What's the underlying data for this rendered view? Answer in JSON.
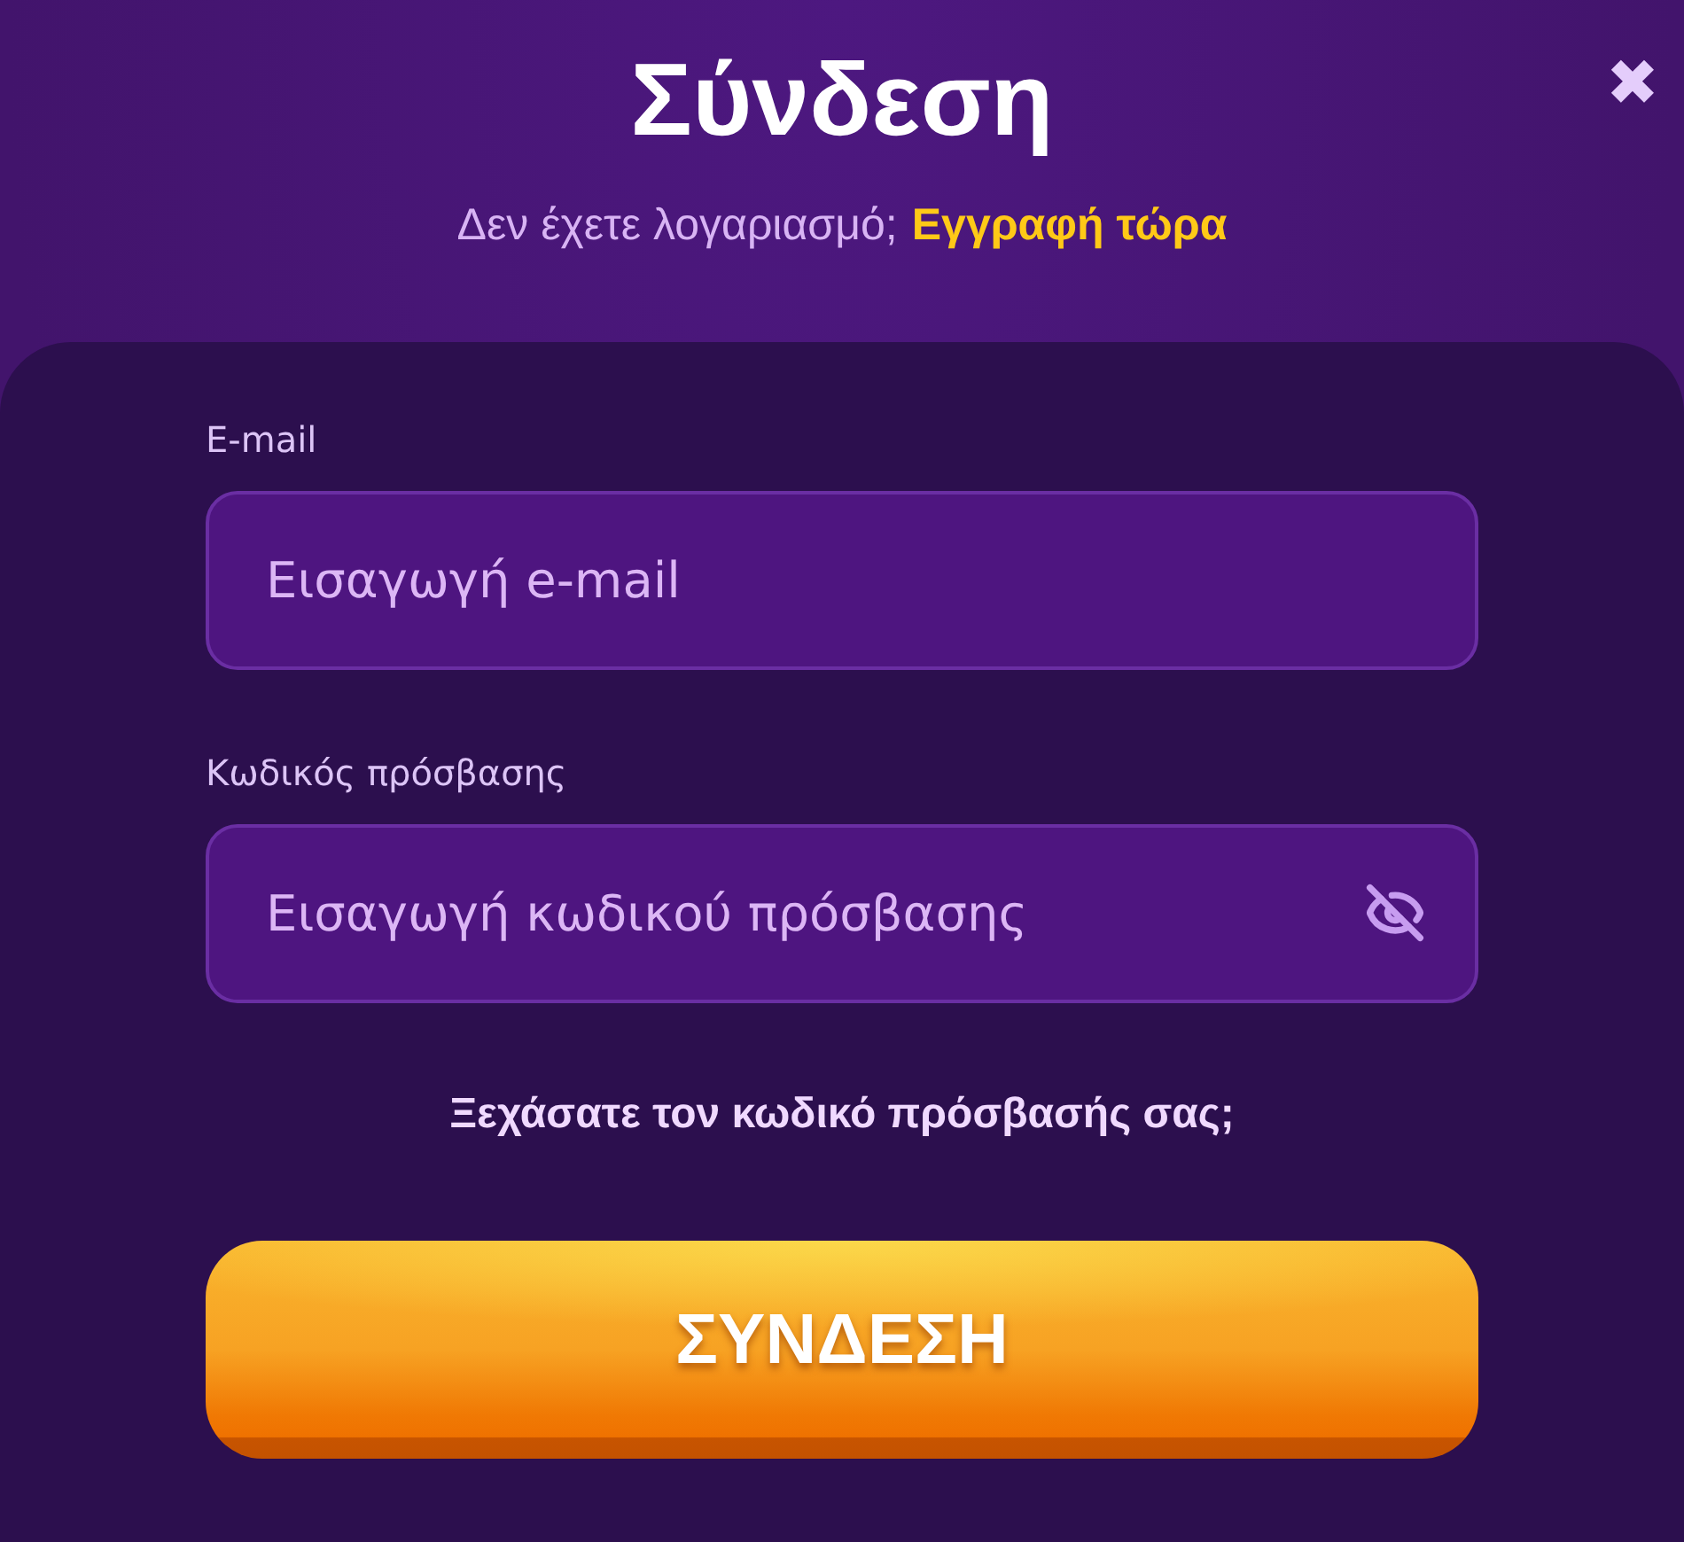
{
  "dialog": {
    "title": "Σύνδεση",
    "close": "✖"
  },
  "signup_prompt": {
    "text": "Δεν έχετε λογαριασμό;",
    "link": "Εγγραφή τώρα"
  },
  "fields": [
    {
      "kind": "text",
      "label": "E-mail",
      "placeholder": "Εισαγωγή e-mail"
    },
    {
      "kind": "password",
      "label": "Κωδικός πρόσβασης",
      "placeholder": "Εισαγωγή κωδικού πρόσβασης"
    }
  ],
  "forgot_link": "Ξεχάσατε τον κωδικό πρόσβασής σας;",
  "submit_button": "ΣΥΝΔΕΣΗ"
}
